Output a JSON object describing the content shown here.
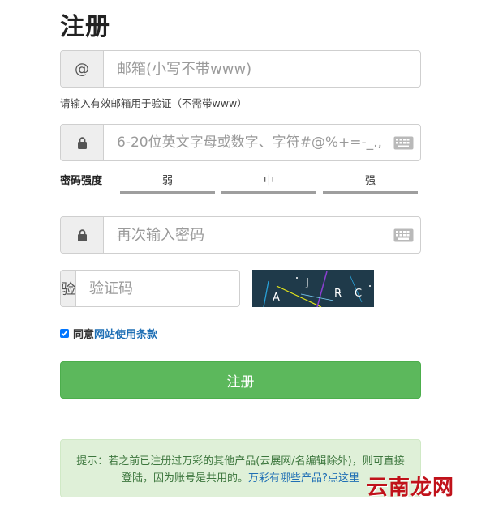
{
  "page": {
    "title": "注册"
  },
  "email": {
    "addon": "@",
    "placeholder": "邮箱(小写不带www)",
    "hint": "请输入有效邮箱用于验证（不需带www）"
  },
  "password": {
    "addon_icon": "lock-icon",
    "placeholder": "6-20位英文字母或数字、字符#@%+=-_.,",
    "keyboard_icon": "keyboard-icon"
  },
  "strength": {
    "label": "密码强度",
    "levels": [
      "弱",
      "中",
      "强"
    ],
    "bar_color": "#9e9e9e"
  },
  "confirm_password": {
    "addon_icon": "lock-icon",
    "placeholder": "再次输入密码",
    "keyboard_icon": "keyboard-icon"
  },
  "captcha": {
    "addon": "验",
    "placeholder": "验证码",
    "image_text": "A J R C"
  },
  "agree": {
    "checked": true,
    "text": "同意",
    "link": "网站使用条款"
  },
  "submit": {
    "label": "注册",
    "color": "#5cb85c"
  },
  "notice": {
    "text": "提示：若之前已注册过万彩的其他产品(云展网/名编辑除外)，则可直接登陆，因为账号是共用的。",
    "link": "万彩有哪些产品?点这里"
  },
  "watermark": {
    "text": "云南龙网"
  }
}
